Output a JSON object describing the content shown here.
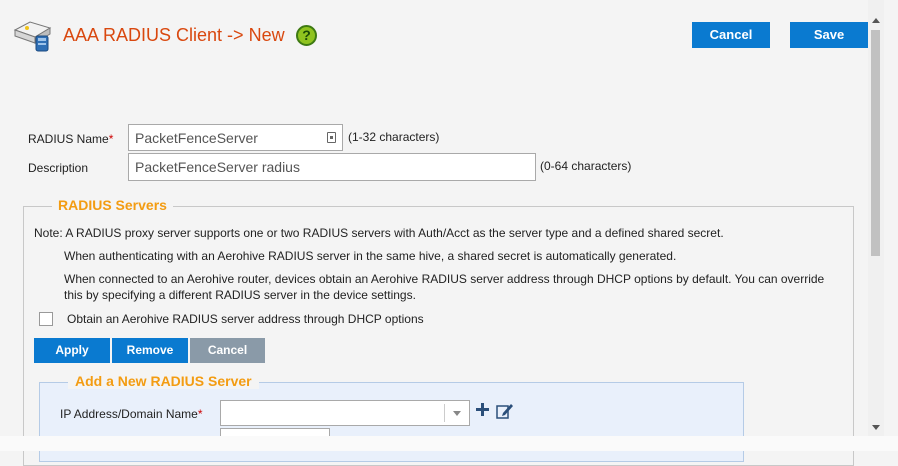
{
  "header": {
    "title": "AAA RADIUS Client -> New",
    "help_icon": "question-mark-icon",
    "help_glyph": "?",
    "cancel_label": "Cancel",
    "save_label": "Save",
    "accent_color": "#0a7ad0",
    "title_color": "#d9480f"
  },
  "form": {
    "radius_name": {
      "label": "RADIUS Name",
      "required_mark": "*",
      "value": "PacketFenceServer",
      "hint": "(1-32 characters)"
    },
    "description": {
      "label": "Description",
      "value": "PacketFenceServer radius",
      "hint": "(0-64 characters)"
    }
  },
  "radius_servers": {
    "legend": "RADIUS Servers",
    "note_1": "Note: A RADIUS proxy server supports one or two RADIUS servers with Auth/Acct as the server type and a defined shared secret.",
    "note_2": "When authenticating with an Aerohive RADIUS server in the same hive, a shared secret is automatically generated.",
    "note_3": "When connected to an Aerohive router, devices obtain an Aerohive RADIUS server address through DHCP options by default. You can override this by specifying a different RADIUS server in the device settings.",
    "dhcp_checkbox": {
      "label": "Obtain an Aerohive RADIUS server address through DHCP options",
      "checked": false
    },
    "buttons": {
      "apply": "Apply",
      "remove": "Remove",
      "cancel": "Cancel"
    },
    "legend_color": "#f39c12"
  },
  "add_server": {
    "legend": "Add a New RADIUS Server",
    "ip_label": "IP Address/Domain Name",
    "required_mark": "*",
    "ip_value": "",
    "add_icon": "plus-icon",
    "edit_icon": "edit-icon"
  }
}
